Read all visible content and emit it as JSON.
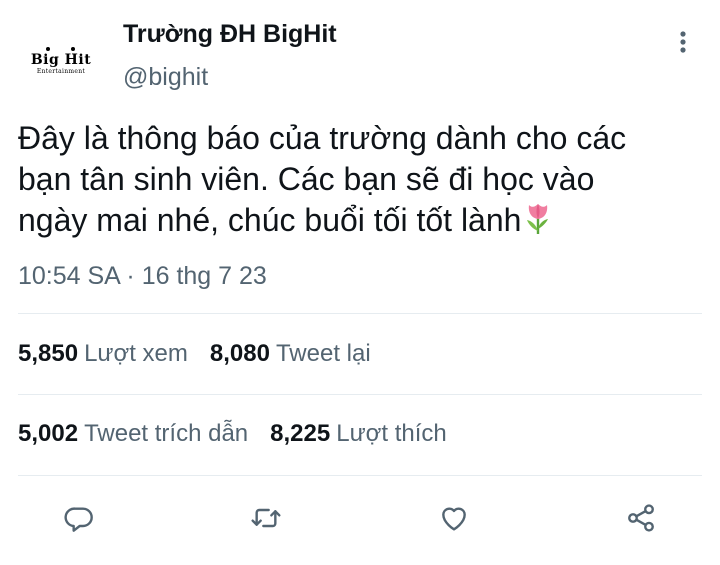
{
  "author": {
    "display_name": "Trường ĐH BigHit",
    "handle": "@bighit",
    "avatar_logo_main": "Big Hit",
    "avatar_logo_sub": "Entertainment"
  },
  "tweet": {
    "text_lines": [
      "Đây là thông báo của trường dành cho các",
      "bạn tân sinh viên. Các bạn sẽ đi học vào",
      "ngày mai nhé, chúc buổi tối tốt lành"
    ],
    "timestamp": "10:54 SA · 16 thg 7 23",
    "emoji": "tulip-emoji"
  },
  "stats": {
    "views": {
      "count": "5,850",
      "label": "Lượt xem"
    },
    "retweets": {
      "count": "8,080",
      "label": "Tweet lại"
    },
    "quotes": {
      "count": "5,002",
      "label": "Tweet trích dẫn"
    },
    "likes": {
      "count": "8,225",
      "label": "Lượt thích"
    }
  },
  "actions": [
    "reply-icon",
    "retweet-icon",
    "like-icon",
    "share-icon"
  ],
  "colors": {
    "primary_text": "#0f1419",
    "secondary_text": "#536471",
    "divider": "#e6ecf0",
    "icon": "#536471"
  }
}
